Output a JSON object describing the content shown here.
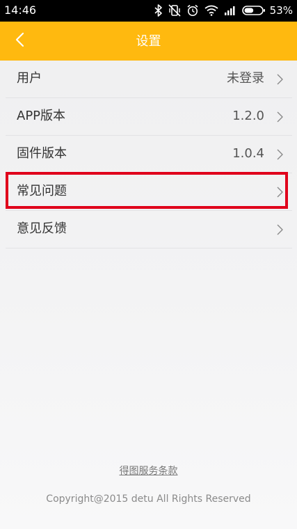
{
  "status_bar": {
    "time": "14:46",
    "battery_percent": "53%",
    "battery_level": 0.53,
    "icons": [
      "bluetooth-icon",
      "vibrate-icon",
      "alarm-icon",
      "wifi-icon",
      "signal-icon",
      "battery-icon"
    ]
  },
  "app_bar": {
    "title": "设置",
    "back_icon": "chevron-left-icon",
    "background": "#ffb90f"
  },
  "settings": {
    "items": [
      {
        "label": "用户",
        "value": "未登录"
      },
      {
        "label": "APP版本",
        "value": "1.2.0"
      },
      {
        "label": "固件版本",
        "value": "1.0.4"
      },
      {
        "label": "常见问题",
        "value": ""
      },
      {
        "label": "意见反馈",
        "value": ""
      }
    ],
    "highlighted_item": "常见问题",
    "highlight_color": "#e0001b"
  },
  "footer": {
    "terms": "得图服务条款",
    "copyright": "Copyright@2015 detu All Rights Reserved"
  }
}
